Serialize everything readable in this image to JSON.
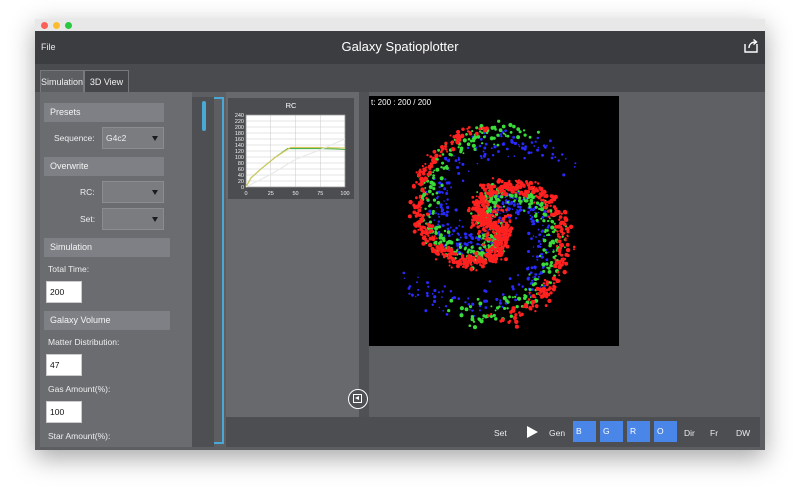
{
  "app": {
    "title": "Galaxy Spatioplotter",
    "menu": {
      "file": "File"
    }
  },
  "tabs": [
    {
      "label": "Simulation"
    },
    {
      "label": "3D View"
    }
  ],
  "left_panel": {
    "presets": {
      "header": "Presets",
      "sequence_label": "Sequence:",
      "sequence_value": "G4c2"
    },
    "overwrite": {
      "header": "Overwrite",
      "rc_label": "RC:",
      "set_label": "Set:"
    },
    "simulation": {
      "header": "Simulation",
      "total_time_label": "Total Time:",
      "total_time_value": "200"
    },
    "galaxy_volume": {
      "header": "Galaxy Volume",
      "matter_distribution_label": "Matter Distribution:",
      "matter_distribution_value": "47",
      "gas_amount_label": "Gas Amount(%):",
      "gas_amount_value": "100",
      "star_amount_label": "Star Amount(%):"
    }
  },
  "simulation_view": {
    "status": "t: 200 : 200 / 200"
  },
  "toolbar": {
    "set": "Set",
    "gen": "Gen",
    "b": "B",
    "g": "G",
    "r": "R",
    "o": "O",
    "dir": "Dir",
    "fr": "Fr",
    "dw": "DW"
  },
  "chart_data": {
    "type": "line",
    "title": "RC",
    "xlabel": "",
    "ylabel": "",
    "xlim": [
      0,
      100
    ],
    "ylim": [
      0,
      240
    ],
    "xticks": [
      0,
      25,
      50,
      75,
      100
    ],
    "yticks": [
      0,
      20,
      40,
      60,
      80,
      100,
      120,
      140,
      160,
      180,
      200,
      220,
      240
    ],
    "grid": true,
    "series": [
      {
        "color": "#4caf50",
        "x": [
          0,
          5,
          15,
          30,
          42,
          50,
          60,
          75,
          90,
          100
        ],
        "y": [
          0,
          30,
          60,
          100,
          128,
          128,
          128,
          128,
          127,
          125
        ]
      },
      {
        "color": "#d6c85a",
        "x": [
          0,
          5,
          15,
          30,
          45,
          55,
          70,
          85,
          100
        ],
        "y": [
          0,
          30,
          60,
          100,
          132,
          132,
          132,
          131,
          130
        ]
      },
      {
        "color": "#e8e8e8",
        "x": [
          0,
          25,
          50,
          75,
          100
        ],
        "y": [
          0,
          42,
          92,
          124,
          160
        ]
      }
    ]
  },
  "colors": {
    "accent": "#4a86e8",
    "scroll": "#49a8d6",
    "galaxy_red": "#ff2020",
    "galaxy_green": "#3adb3a",
    "galaxy_blue": "#2a2aff"
  },
  "icons": {
    "share": "share-icon",
    "play": "play-icon",
    "collapse": "collapse-panel-icon"
  }
}
